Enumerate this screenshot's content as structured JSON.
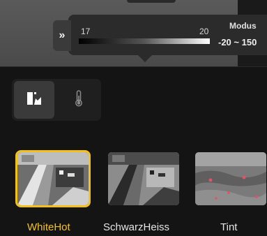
{
  "range_popup": {
    "min_label": "17",
    "max_label": "20",
    "modus_label": "Modus",
    "modus_value": "-20 ~ 150"
  },
  "modes": {
    "active": "palette-mode",
    "palette_icon": "palette-icon",
    "temperature_icon": "thermometer-icon"
  },
  "palettes": [
    {
      "label": "WhiteHot",
      "selected": true
    },
    {
      "label": "SchwarzHeiss",
      "selected": false
    },
    {
      "label": "Tint",
      "selected": false
    }
  ],
  "colors": {
    "accent": "#f2c21b",
    "background": "#141414",
    "popup": "#2b2b2b"
  }
}
